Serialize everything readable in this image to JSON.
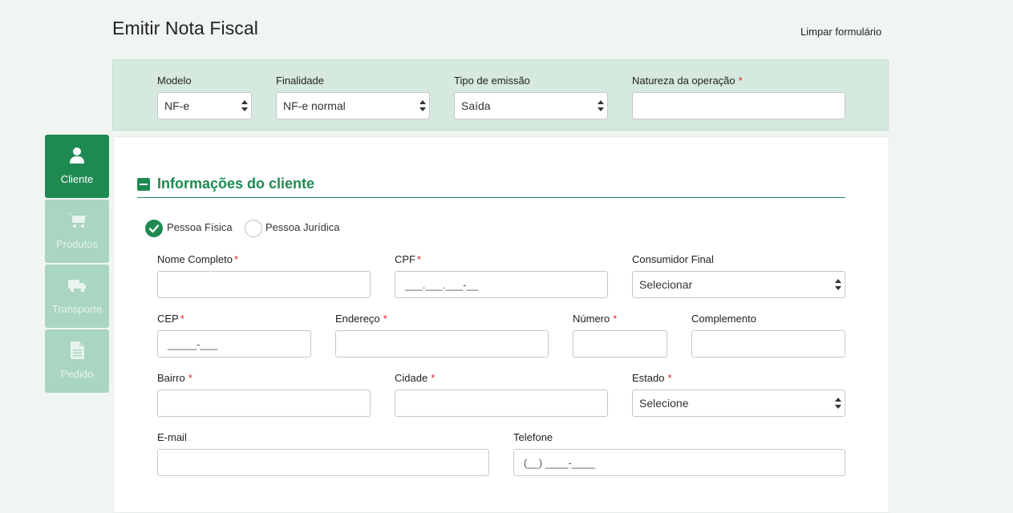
{
  "header": {
    "title": "Emitir Nota Fiscal",
    "clear_label": "Limpar formulário"
  },
  "top_bar": {
    "modelo_label": "Modelo",
    "modelo_value": "NF-e",
    "finalidade_label": "Finalidade",
    "finalidade_value": "NF-e normal",
    "tipo_label": "Tipo de emissão",
    "tipo_value": "Saída",
    "natureza_label": "Natureza da operação",
    "natureza_value": ""
  },
  "sidebar": {
    "items": [
      {
        "label": "Cliente",
        "icon": "user-icon",
        "active": true
      },
      {
        "label": "Produtos",
        "icon": "cart-icon",
        "active": false
      },
      {
        "label": "Transporte",
        "icon": "truck-icon",
        "active": false
      },
      {
        "label": "Pedido",
        "icon": "document-icon",
        "active": false
      }
    ]
  },
  "section": {
    "title": "Informações do cliente"
  },
  "person_type": {
    "fisica_label": "Pessoa Física",
    "juridica_label": "Pessoa Jurídica",
    "selected": "fisica"
  },
  "form": {
    "nome_label": "Nome Completo",
    "nome_value": "",
    "cpf_label": "CPF",
    "cpf_placeholder": "___.___.___-__",
    "consumidor_label": "Consumidor Final",
    "consumidor_value": "Selecionar",
    "cep_label": "CEP",
    "cep_placeholder": "_____-___",
    "endereco_label": "Endereço",
    "endereco_value": "",
    "numero_label": "Número",
    "numero_value": "",
    "complemento_label": "Complemento",
    "complemento_value": "",
    "bairro_label": "Bairro",
    "bairro_value": "",
    "cidade_label": "Cidade",
    "cidade_value": "",
    "estado_label": "Estado",
    "estado_value": "Selecione",
    "email_label": "E-mail",
    "email_value": "",
    "telefone_label": "Telefone",
    "telefone_placeholder": "(__) ____-____"
  },
  "required_marker": "*",
  "colors": {
    "accent": "#1e8a52",
    "accent_light": "#a9d5c1",
    "top_bar_bg": "#d5e9df",
    "required": "#e0262b",
    "page_bg": "#f0f5f2"
  }
}
